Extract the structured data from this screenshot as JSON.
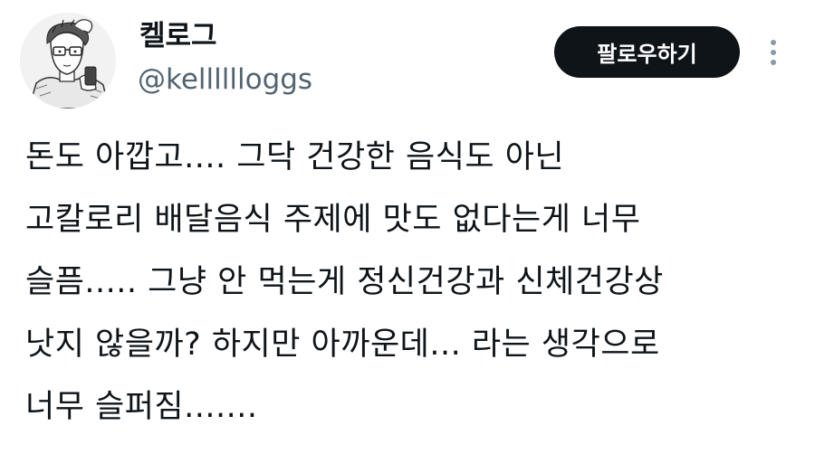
{
  "user": {
    "display_name": "켈로그",
    "handle": "@kelllllloggs"
  },
  "actions": {
    "follow_label": "팔로우하기",
    "more_icon": "more-vertical-icon"
  },
  "tweet": {
    "lines": [
      "돈도 아깝고.... 그닥 건강한 음식도 아닌",
      "고칼로리 배달음식 주제에 맛도 없다는게 너무",
      "슬픔..... 그냥 안 먹는게 정신건강과 신체건강상",
      "낫지 않을까? 하지만 아까운데... 라는 생각으로",
      "너무 슬퍼짐......."
    ]
  },
  "colors": {
    "text": "#0f1419",
    "secondary": "#536471",
    "button_bg": "#0f1419",
    "button_text": "#ffffff",
    "more_dots": "#8b98a5"
  }
}
